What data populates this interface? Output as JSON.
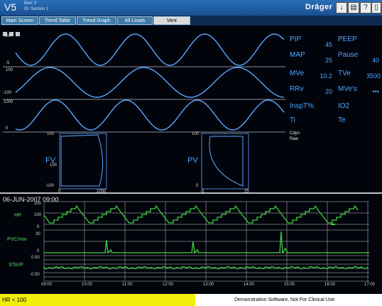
{
  "header": {
    "title": "V5",
    "sub_line1": "Bed: 5",
    "sub_line2": "ID: Section 1",
    "brand": "Dräger",
    "buttons": [
      "↓",
      "▤",
      "?",
      "▯"
    ]
  },
  "tabs": [
    {
      "label": "Main Screen"
    },
    {
      "label": "Trend Table"
    },
    {
      "label": "Trend Graph"
    },
    {
      "label": "All Leads"
    },
    {
      "label": "Vent",
      "active": true
    }
  ],
  "waves": {
    "w1": {
      "top": "25",
      "bottom": "-5"
    },
    "w2": {
      "top": "100",
      "bottom": "-100"
    },
    "w3": {
      "top": "1000",
      "bottom": "0"
    }
  },
  "params": {
    "pip": {
      "label": "PIP",
      "value": "45"
    },
    "peep": {
      "label": "PEEP",
      "value": ""
    },
    "map": {
      "label": "MAP",
      "value": "25"
    },
    "pause": {
      "label": "Pause",
      "value": "40"
    },
    "mve": {
      "label": "MVe",
      "value": "10.2"
    },
    "tve": {
      "label": "TVe",
      "value": "3500"
    },
    "rrv": {
      "label": "RRv",
      "value": "20"
    },
    "mves": {
      "label": "MVe's",
      "value": "•••"
    },
    "inspt": {
      "label": "InspT%",
      "value": ""
    },
    "io2": {
      "label": "IO2",
      "value": ""
    },
    "ti": {
      "label": "Ti",
      "value": ""
    },
    "te": {
      "label": "Te",
      "value": ""
    },
    "cdyn": {
      "label": "Cdyn"
    },
    "raw": {
      "label": "Raw"
    }
  },
  "loops": {
    "fv": {
      "label": "FV",
      "y_top": "100",
      "y_bottom": "-100",
      "x_left": "0",
      "x_right": "1000",
      "x_mid": "100"
    },
    "pv": {
      "label": "PV",
      "y_top": "100",
      "y_bottom": "0",
      "x_left": "-5",
      "x_right": "25"
    }
  },
  "trend": {
    "datetime": "06-JUN-2007  09:00",
    "hr_label": "HR",
    "hr_scale": [
      "200",
      "100",
      "0"
    ],
    "pvc_label": "PVC/min",
    "pvc_scale": [
      "30",
      "0"
    ],
    "stavf_label": "STaVF",
    "stavf_scale": [
      "0.50",
      "-0.50"
    ],
    "x_ticks": [
      "09:00",
      "10:00",
      "11:00",
      "12:00",
      "13:00",
      "14:00",
      "15:00",
      "16:00",
      "17:00"
    ]
  },
  "status": {
    "alarm": "HR < 100",
    "demo_text": "Demonstration Software, Not For Clinical Use"
  }
}
